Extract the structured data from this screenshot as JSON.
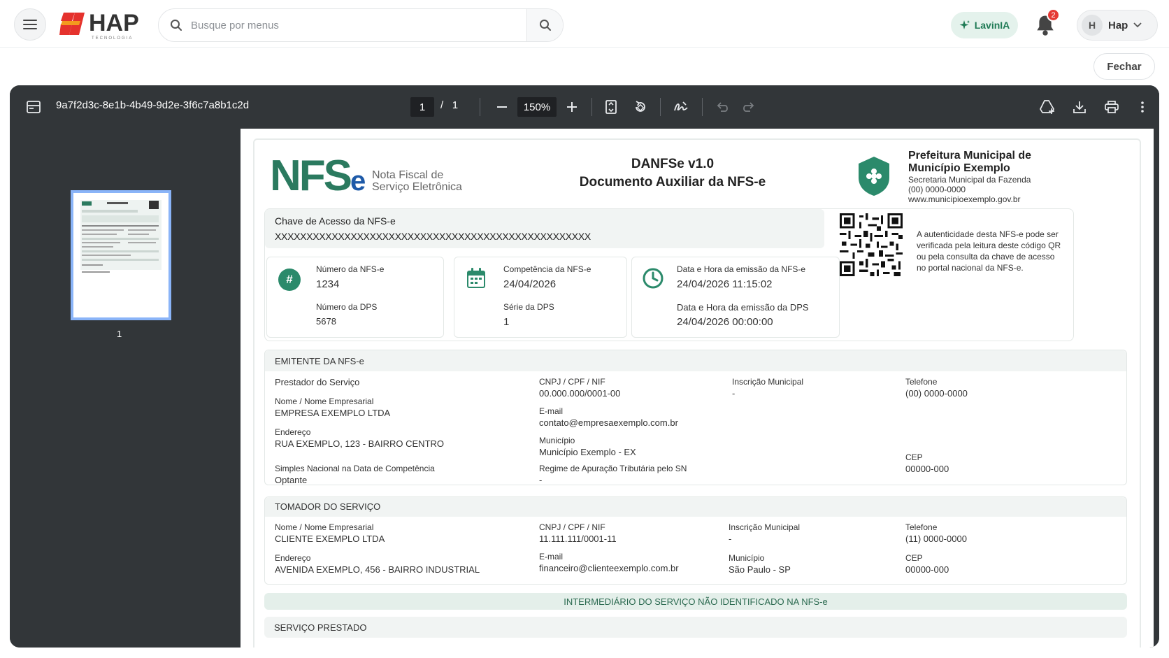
{
  "header": {
    "logo_text": "HAP",
    "logo_sub": "TECNOLOGIA",
    "search_placeholder": "Busque por menus",
    "ai_label": "LavinIA",
    "notif_count": "2",
    "user_initial": "H",
    "user_name": "Hap",
    "close_label": "Fechar"
  },
  "viewer": {
    "file_name": "9a7f2d3c-8e1b-4b49-9d2e-3f6c7a8b1c2d",
    "current_page": "1",
    "page_sep": "/",
    "total_pages": "1",
    "zoom": "150%",
    "thumb_label": "1"
  },
  "doc": {
    "brand_logo": "NFS",
    "brand_logo_e": "e",
    "brand_sub_1": "Nota Fiscal de",
    "brand_sub_2": "Serviço Eletrônica",
    "title_1": "DANFSe v1.0",
    "title_2": "Documento Auxiliar da NFS-e",
    "pref_title_1": "Prefeitura Municipal de",
    "pref_title_2": "Município Exemplo",
    "pref_sec": "Secretaria Municipal da Fazenda",
    "pref_phone": "(00) 0000-0000",
    "pref_site": "www.municipioexemplo.gov.br",
    "chave_label": "Chave de Acesso da NFS-e",
    "chave_value": "XXXXXXXXXXXXXXXXXXXXXXXXXXXXXXXXXXXXXXXXXXXXXXXXXX",
    "qr_text": "A autenticidade desta NFS-e pode ser verificada pela leitura deste código QR ou pela consulta da chave de acesso no portal nacional da NFS-e.",
    "numero_label": "Número da NFS-e",
    "numero_value": "1234",
    "dps_label": "Número da DPS",
    "dps_value": "5678",
    "comp_label": "Competência da NFS-e",
    "comp_value": "24/04/2026",
    "serie_label": "Série da DPS",
    "serie_value": "1",
    "emissao_label": "Data e Hora da emissão da NFS-e",
    "emissao_value": "24/04/2026 11:15:02",
    "emissao_dps_label": "Data e Hora da emissão da DPS",
    "emissao_dps_value": "24/04/2026 00:00:00"
  },
  "emitente": {
    "title": "EMITENTE DA NFS-e",
    "prestador": "Prestador do Serviço",
    "nome_label": "Nome / Nome Empresarial",
    "nome_value": "EMPRESA EXEMPLO LTDA",
    "end_label": "Endereço",
    "end_value": "RUA EXEMPLO, 123 - BAIRRO CENTRO",
    "simples_label": "Simples Nacional na Data de Competência",
    "simples_value": "Optante",
    "cnpj_label": "CNPJ / CPF / NIF",
    "cnpj_value": "00.000.000/0001-00",
    "email_label": "E-mail",
    "email_value": "contato@empresaexemplo.com.br",
    "mun_label": "Município",
    "mun_value": "Município Exemplo - EX",
    "regime_label": "Regime de Apuração Tributária pelo SN",
    "regime_value": "-",
    "im_label": "Inscrição Municipal",
    "im_value": "-",
    "tel_label": "Telefone",
    "tel_value": "(00) 0000-0000",
    "cep_label": "CEP",
    "cep_value": "00000-000"
  },
  "tomador": {
    "title": "TOMADOR DO SERVIÇO",
    "nome_label": "Nome / Nome Empresarial",
    "nome_value": "CLIENTE EXEMPLO LTDA",
    "end_label": "Endereço",
    "end_value": "AVENIDA EXEMPLO, 456 - BAIRRO INDUSTRIAL",
    "cnpj_label": "CNPJ / CPF / NIF",
    "cnpj_value": "11.111.111/0001-11",
    "email_label": "E-mail",
    "email_value": "financeiro@clienteexemplo.com.br",
    "im_label": "Inscrição Municipal",
    "im_value": "-",
    "mun_label": "Município",
    "mun_value": "São Paulo - SP",
    "tel_label": "Telefone",
    "tel_value": "(11) 0000-0000",
    "cep_label": "CEP",
    "cep_value": "00000-000"
  },
  "intermediario": "INTERMEDIÁRIO DO SERVIÇO NÃO IDENTIFICADO NA NFS-e",
  "servico_title": "SERVIÇO PRESTADO",
  "colors": {
    "accent_green": "#2b8a6b",
    "viewer_bg": "#323639",
    "badge_red": "#e53935"
  }
}
